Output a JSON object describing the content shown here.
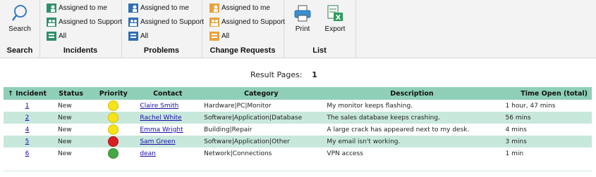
{
  "ribbon": {
    "search": {
      "label": "Search",
      "group": "Search"
    },
    "incidents": {
      "group": "Incidents",
      "items": [
        "Assigned to me",
        "Assigned to Support",
        "All"
      ]
    },
    "problems": {
      "group": "Problems",
      "items": [
        "Assigned to me",
        "Assigned to Support",
        "All"
      ]
    },
    "change_requests": {
      "group": "Change Requests",
      "items": [
        "Assigned to me",
        "Assigned to Support",
        "All"
      ]
    },
    "list": {
      "group": "List",
      "print": "Print",
      "export": "Export"
    }
  },
  "result_pages": {
    "label": "Result Pages:",
    "current": "1"
  },
  "table": {
    "columns": [
      "↑ Incident",
      "Status",
      "Priority",
      "Contact",
      "Category",
      "Description",
      "Time Open (total)"
    ],
    "rows": [
      {
        "id": "1",
        "status": "New",
        "priority": "yellow",
        "contact": "Claire Smith",
        "category": "Hardware|PC|Monitor",
        "description": "My monitor keeps flashing.",
        "time": "1 hour, 47 mins"
      },
      {
        "id": "2",
        "status": "New",
        "priority": "yellow",
        "contact": "Rachel White",
        "category": "Software|Application|Database",
        "description": "The sales database keeps crashing.",
        "time": "56 mins"
      },
      {
        "id": "4",
        "status": "New",
        "priority": "yellow",
        "contact": "Emma Wright",
        "category": "Building|Repair",
        "description": "A large crack has appeared next to my desk.",
        "time": "4 mins"
      },
      {
        "id": "5",
        "status": "New",
        "priority": "red",
        "contact": "Sam Green",
        "category": "Software|Application|Other",
        "description": "My email isn't working.",
        "time": "3 mins"
      },
      {
        "id": "6",
        "status": "New",
        "priority": "green",
        "contact": "dean",
        "category": "Network|Connections",
        "description": "VPN access",
        "time": "1 min"
      }
    ]
  },
  "colors": {
    "header": "#8fcfb8",
    "alt_row": "#c8e8dc",
    "priority_yellow": "#f6e318",
    "priority_red": "#d92020",
    "priority_green": "#45a845"
  }
}
